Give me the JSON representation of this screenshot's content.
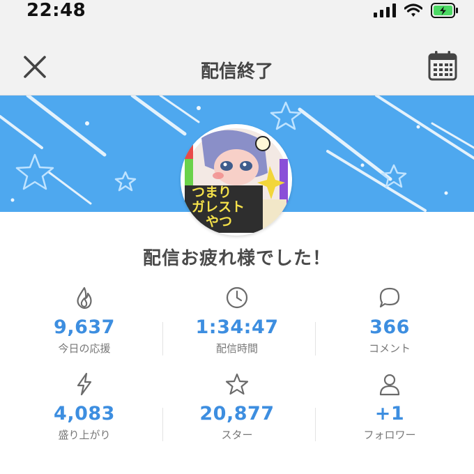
{
  "status_bar": {
    "time": "22:48"
  },
  "header": {
    "title": "配信終了"
  },
  "avatar": {
    "lines": [
      "つまり",
      "ガレスト",
      "やつ"
    ]
  },
  "message": "配信お疲れ様でした！",
  "stats": [
    {
      "value": "9,637",
      "label": "今日の応援",
      "icon": "flame-icon"
    },
    {
      "value": "1:34:47",
      "label": "配信時間",
      "icon": "clock-icon"
    },
    {
      "value": "366",
      "label": "コメント",
      "icon": "comment-icon"
    },
    {
      "value": "4,083",
      "label": "盛り上がり",
      "icon": "lightning-icon"
    },
    {
      "value": "20,877",
      "label": "スター",
      "icon": "star-icon"
    },
    {
      "value": "+1",
      "label": "フォロワー",
      "icon": "person-icon"
    }
  ],
  "colors": {
    "banner": "#4ea8ef",
    "accent": "#3d8ee0",
    "battery": "#4cd964"
  }
}
